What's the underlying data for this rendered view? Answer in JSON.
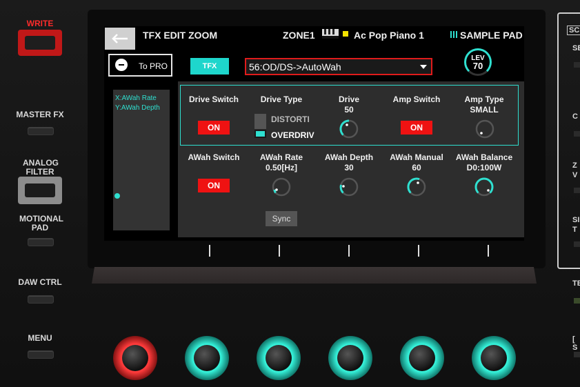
{
  "hardware": {
    "left_buttons": {
      "write": "WRITE",
      "master_fx": "MASTER FX",
      "analog_filter": "ANALOG FILTER",
      "motional_pad": "MOTIONAL PAD",
      "daw_ctrl": "DAW CTRL",
      "menu": "MENU"
    },
    "right_labels": [
      "SC",
      "SE",
      "C",
      "Z",
      "V",
      "SI",
      "T",
      "TE",
      "[ S"
    ]
  },
  "header": {
    "title": "TFX EDIT ZOOM",
    "zone": "ZONE1",
    "tone_name": "Ac Pop Piano 1",
    "sample_pad_label": "SAMPLE PAD"
  },
  "toolbar": {
    "to_pro_label": "To PRO",
    "tfx_label": "TFX",
    "effect_type": "56:OD/DS->AutoWah",
    "level_label": "LEV",
    "level_value": "70"
  },
  "xy_pad": {
    "x_assign": "X:AWah Rate",
    "y_assign": "Y:AWah Depth"
  },
  "params_row1": {
    "drive_switch": {
      "label": "Drive Switch",
      "value": "ON"
    },
    "drive_type": {
      "label": "Drive Type",
      "options": [
        "DISTORTI",
        "OVERDRIV"
      ],
      "selected": "OVERDRIV"
    },
    "drive": {
      "label": "Drive",
      "value": "50"
    },
    "amp_switch": {
      "label": "Amp Switch",
      "value": "ON"
    },
    "amp_type": {
      "label": "Amp Type",
      "value": "SMALL"
    }
  },
  "params_row2": {
    "awah_switch": {
      "label": "AWah Switch",
      "value": "ON"
    },
    "awah_rate": {
      "label": "AWah Rate",
      "value": "0.50[Hz]",
      "sync_label": "Sync"
    },
    "awah_depth": {
      "label": "AWah Depth",
      "value": "30"
    },
    "awah_manual": {
      "label": "AWah Manual",
      "value": "60"
    },
    "awah_balance": {
      "label": "AWah Balance",
      "value": "D0:100W"
    }
  },
  "colors": {
    "accent": "#2fe0d0",
    "on_red": "#ef1212",
    "select_border": "#e01b1b",
    "zone_badge": "#f2e200"
  }
}
